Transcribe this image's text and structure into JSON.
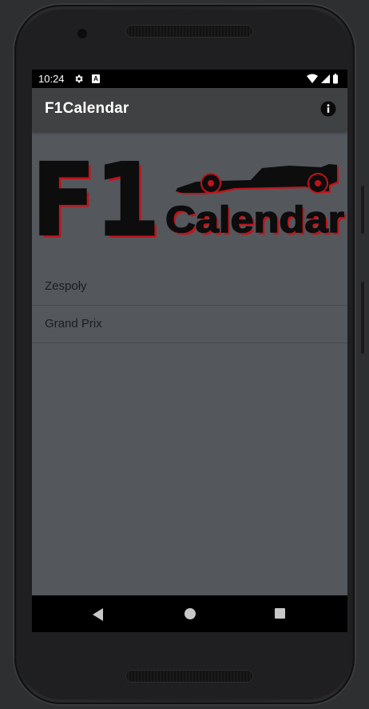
{
  "status_bar": {
    "time": "10:24",
    "icons": [
      "settings-icon",
      "a-notification-icon",
      "wifi-icon",
      "signal-icon",
      "battery-icon"
    ]
  },
  "app_bar": {
    "title": "F1Calendar",
    "info_icon": "info-icon"
  },
  "logo": {
    "big_text": "F1",
    "word": "Calendar",
    "colors": {
      "fill": "#0d0d0d",
      "outline": "#c0141a"
    }
  },
  "menu": {
    "items": [
      {
        "label": "Zespoły"
      },
      {
        "label": "Grand Prix"
      }
    ]
  },
  "nav_bar": {
    "icons": [
      "back-icon",
      "home-icon",
      "recents-icon"
    ]
  },
  "colors": {
    "screen_bg": "#54575c",
    "app_bar_bg": "#404142",
    "status_bar_bg": "#000000",
    "nav_bar_bg": "#000000"
  }
}
